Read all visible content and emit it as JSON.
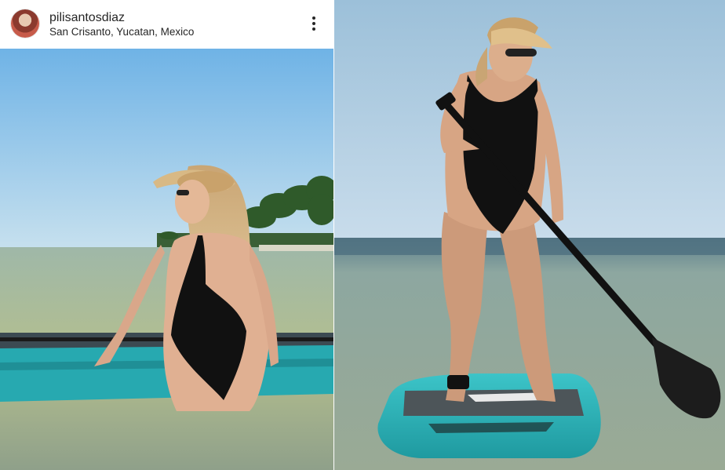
{
  "post": {
    "username": "pilisantosdiaz",
    "location": "San Crisanto, Yucatan, Mexico"
  },
  "icons": {
    "avatar": "profile-avatar",
    "more": "more-options-icon"
  },
  "colors": {
    "sky": "#8fc4e6",
    "water": "#8aa49a",
    "board": "#2bb5b8",
    "swimsuit": "#111111"
  }
}
